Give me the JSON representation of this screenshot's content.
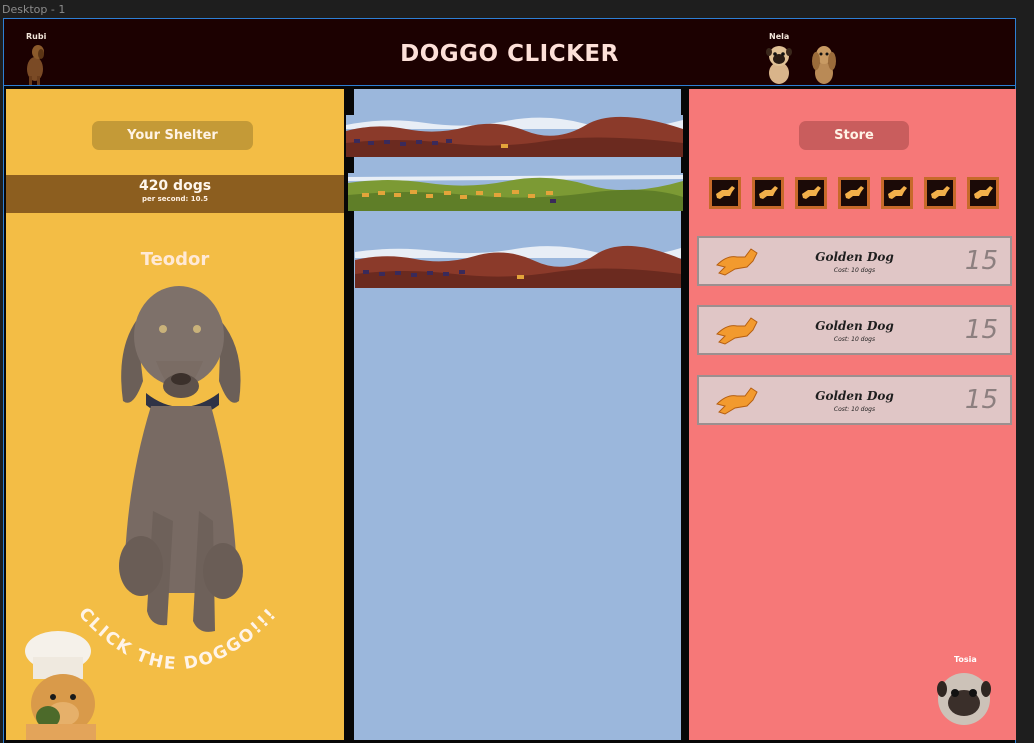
{
  "window": {
    "frame_label": "Desktop - 1"
  },
  "header": {
    "title": "DOGGO CLICKER",
    "left_dog_name": "Rubi",
    "right_dog_name": "Nela"
  },
  "shelter": {
    "button_label": "Your Shelter",
    "dog_count": "420 dogs",
    "per_second": "per second: 10.5",
    "dog_name": "Teodor",
    "click_prompt": "CLICK THE DOGGO!!!"
  },
  "store": {
    "button_label": "Store",
    "shop_icon": "running-dog-icon",
    "shop_icon_count": 7,
    "items": [
      {
        "name": "Golden Dog",
        "cost": "Cost: 10 dogs",
        "count": "15"
      },
      {
        "name": "Golden Dog",
        "cost": "Cost: 10 dogs",
        "count": "15"
      },
      {
        "name": "Golden Dog",
        "cost": "Cost: 10 dogs",
        "count": "15"
      }
    ],
    "corner_dog_name": "Tosia"
  },
  "colors": {
    "shelter_bg": "#f3bd45",
    "field_bg": "#9bb7dc",
    "store_bg": "#f67878",
    "header_bg": "#1c0101"
  }
}
